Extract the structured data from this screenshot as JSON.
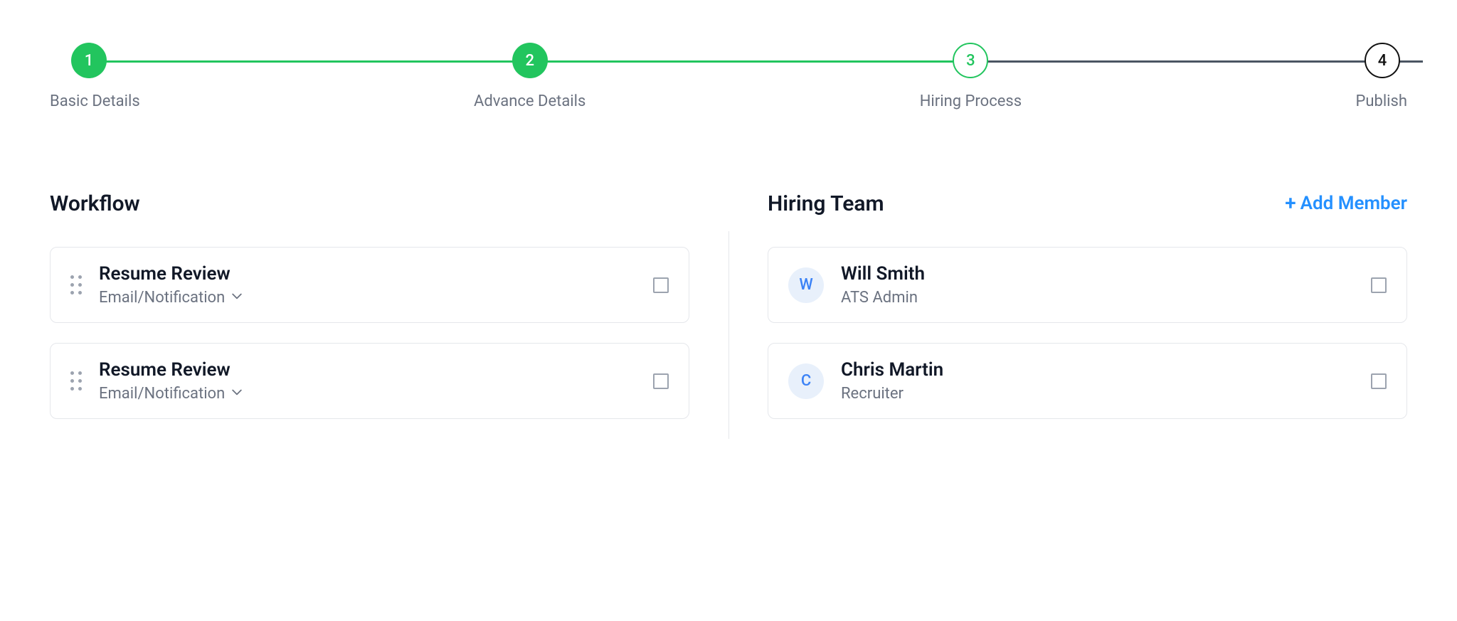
{
  "stepper": {
    "steps": [
      {
        "num": "1",
        "label": "Basic Details",
        "state": "completed"
      },
      {
        "num": "2",
        "label": "Advance Details",
        "state": "completed"
      },
      {
        "num": "3",
        "label": "Hiring Process",
        "state": "current"
      },
      {
        "num": "4",
        "label": "Publish",
        "state": "upcoming"
      }
    ]
  },
  "workflow": {
    "heading": "Workflow",
    "items": [
      {
        "title": "Resume Review",
        "sub": "Email/Notification"
      },
      {
        "title": "Resume Review",
        "sub": "Email/Notification"
      }
    ]
  },
  "hiring_team": {
    "heading": "Hiring Team",
    "add_label": "Add Member",
    "members": [
      {
        "initial": "W",
        "name": "Will Smith",
        "role": "ATS Admin"
      },
      {
        "initial": "C",
        "name": "Chris Martin",
        "role": "Recruiter"
      }
    ]
  }
}
